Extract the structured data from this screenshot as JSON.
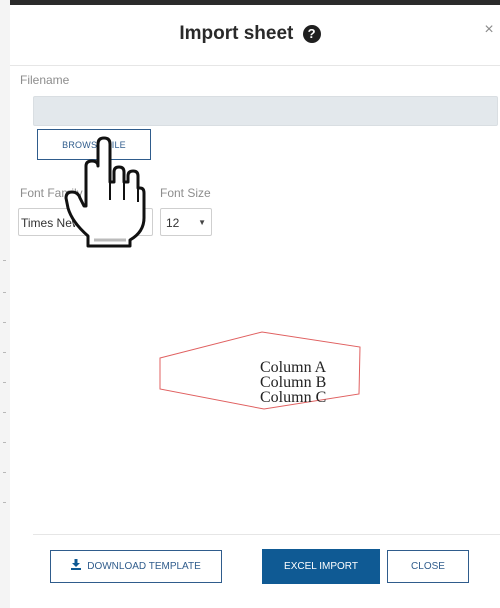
{
  "dialog": {
    "title": "Import sheet",
    "close_symbol": "×",
    "help_symbol": "?"
  },
  "form": {
    "filename_label": "Filename",
    "filename_value": "",
    "browse_label": "BROWSE FILE",
    "font_family_label": "Font Family",
    "font_family_value": "Times New Roman",
    "font_size_label": "Font Size",
    "font_size_value": "12"
  },
  "preview": {
    "lines": [
      "Column A",
      "Column B",
      "Column C"
    ]
  },
  "footer": {
    "download_template_label": "DOWNLOAD TEMPLATE",
    "excel_import_label": "EXCEL IMPORT",
    "close_label": "CLOSE"
  },
  "colors": {
    "primary": "#0f5a94",
    "outline": "#2f5c8c",
    "preview_border": "#e06060"
  },
  "icons": [
    "help-icon",
    "close-icon",
    "download-icon",
    "hand-cursor-icon"
  ]
}
